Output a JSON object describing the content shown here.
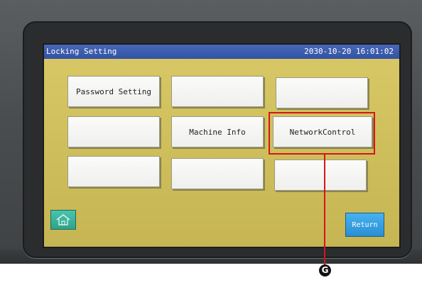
{
  "window": {
    "title": "Locking Setting",
    "datetime": "2030-10-20 16:01:02"
  },
  "grid": {
    "rows": [
      [
        "Password Setting",
        "",
        ""
      ],
      [
        "",
        "Machine Info",
        "NetworkControl"
      ],
      [
        "",
        "",
        ""
      ]
    ]
  },
  "footer": {
    "home_icon": "home-icon",
    "return_label": "Return"
  },
  "annotation": {
    "marker_label": "G",
    "highlight_color": "#d6141c",
    "highlight_target": "NetworkControl"
  },
  "colors": {
    "screen_bg": "#d3c461",
    "titlebar": "#3a5aa9",
    "home_button": "#36b29b",
    "return_button": "#3aa2e3"
  }
}
